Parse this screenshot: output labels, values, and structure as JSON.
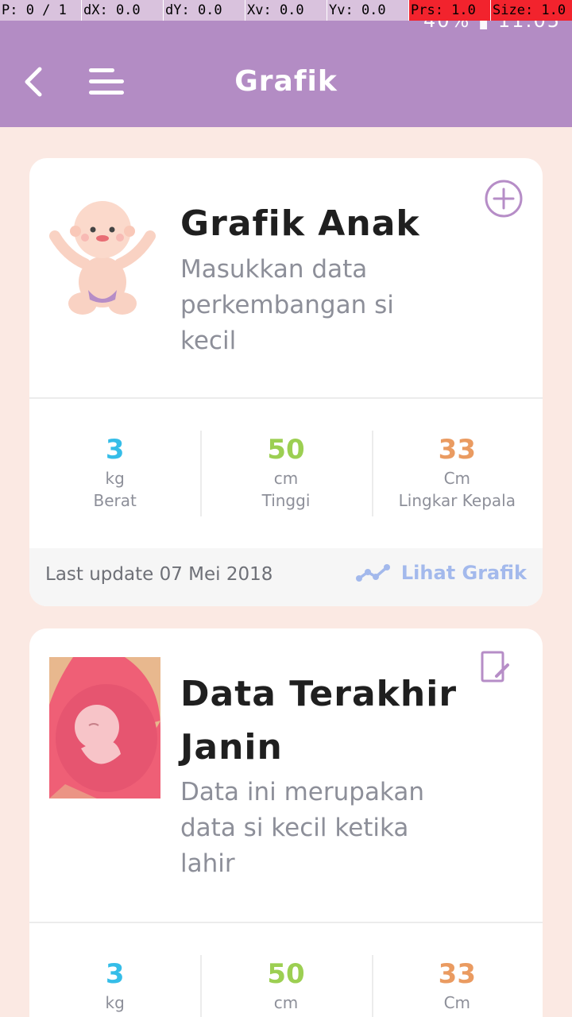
{
  "debug": [
    "P: 0 / 1",
    "dX: 0.0",
    "dY: 0.0",
    "Xv: 0.0",
    "Yv: 0.0",
    "Prs: 1.0",
    "Size: 1.0"
  ],
  "status": {
    "battery": "40%",
    "time": "11:05"
  },
  "header": {
    "title": "Grafik"
  },
  "child_card": {
    "title": "Grafik Anak",
    "description": "Masukkan data perkembangan si kecil",
    "stats": [
      {
        "value": "3",
        "unit": "kg",
        "label": "Berat",
        "color": "#35bde8"
      },
      {
        "value": "50",
        "unit": "cm",
        "label": "Tinggi",
        "color": "#9ccf52"
      },
      {
        "value": "33",
        "unit": "Cm",
        "label": "Lingkar Kepala",
        "color": "#ea9b61"
      }
    ],
    "last_update": "Last update 07 Mei 2018",
    "link_label": "Lihat Grafik"
  },
  "fetus_card": {
    "title_line1": "Data Terakhir",
    "title_line2": "Janin",
    "description": "Data ini merupakan data si kecil ketika lahir",
    "stats": [
      {
        "value": "3",
        "unit": "kg",
        "color": "#35bde8"
      },
      {
        "value": "50",
        "unit": "cm",
        "color": "#9ccf52"
      },
      {
        "value": "33",
        "unit": "Cm",
        "color": "#ea9b61"
      }
    ]
  },
  "colors": {
    "header_bg": "#b38cc4",
    "page_bg": "#fbe9e3",
    "link": "#a3b9ec",
    "icon_purple": "#b68dc7"
  }
}
